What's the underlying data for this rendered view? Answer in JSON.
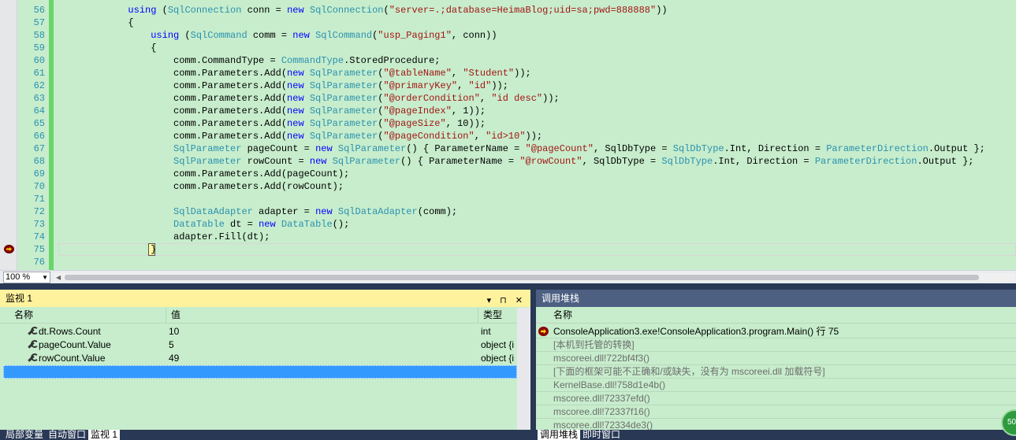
{
  "editor": {
    "lines": [
      {
        "n": "56",
        "t": [
          [
            "            ",
            ""
          ],
          [
            "using",
            "kw"
          ],
          [
            " (",
            ""
          ],
          [
            "SqlConnection",
            "ty"
          ],
          [
            " conn = ",
            ""
          ],
          [
            "new",
            "kw"
          ],
          [
            " ",
            ""
          ],
          [
            "SqlConnection",
            "ty"
          ],
          [
            "(",
            ""
          ],
          [
            "\"server=.;database=HeimaBlog;uid=sa;pwd=888888\"",
            "st"
          ],
          [
            "))",
            ""
          ]
        ]
      },
      {
        "n": "57",
        "t": [
          [
            "            {",
            ""
          ]
        ]
      },
      {
        "n": "58",
        "t": [
          [
            "                ",
            ""
          ],
          [
            "using",
            "kw"
          ],
          [
            " (",
            ""
          ],
          [
            "SqlCommand",
            "ty"
          ],
          [
            " comm = ",
            ""
          ],
          [
            "new",
            "kw"
          ],
          [
            " ",
            ""
          ],
          [
            "SqlCommand",
            "ty"
          ],
          [
            "(",
            ""
          ],
          [
            "\"usp_Paging1\"",
            "st"
          ],
          [
            ", conn))",
            ""
          ]
        ]
      },
      {
        "n": "59",
        "t": [
          [
            "                {",
            ""
          ]
        ]
      },
      {
        "n": "60",
        "t": [
          [
            "                    comm.CommandType = ",
            ""
          ],
          [
            "CommandType",
            "ty"
          ],
          [
            ".StoredProcedure;",
            ""
          ]
        ]
      },
      {
        "n": "61",
        "t": [
          [
            "                    comm.Parameters.Add(",
            ""
          ],
          [
            "new",
            "kw"
          ],
          [
            " ",
            ""
          ],
          [
            "SqlParameter",
            "ty"
          ],
          [
            "(",
            ""
          ],
          [
            "\"@tableName\"",
            "st"
          ],
          [
            ", ",
            ""
          ],
          [
            "\"Student\"",
            "st"
          ],
          [
            "));",
            ""
          ]
        ]
      },
      {
        "n": "62",
        "t": [
          [
            "                    comm.Parameters.Add(",
            ""
          ],
          [
            "new",
            "kw"
          ],
          [
            " ",
            ""
          ],
          [
            "SqlParameter",
            "ty"
          ],
          [
            "(",
            ""
          ],
          [
            "\"@primaryKey\"",
            "st"
          ],
          [
            ", ",
            ""
          ],
          [
            "\"id\"",
            "st"
          ],
          [
            "));",
            ""
          ]
        ]
      },
      {
        "n": "63",
        "t": [
          [
            "                    comm.Parameters.Add(",
            ""
          ],
          [
            "new",
            "kw"
          ],
          [
            " ",
            ""
          ],
          [
            "SqlParameter",
            "ty"
          ],
          [
            "(",
            ""
          ],
          [
            "\"@orderCondition\"",
            "st"
          ],
          [
            ", ",
            ""
          ],
          [
            "\"id desc\"",
            "st"
          ],
          [
            "));",
            ""
          ]
        ]
      },
      {
        "n": "64",
        "t": [
          [
            "                    comm.Parameters.Add(",
            ""
          ],
          [
            "new",
            "kw"
          ],
          [
            " ",
            ""
          ],
          [
            "SqlParameter",
            "ty"
          ],
          [
            "(",
            ""
          ],
          [
            "\"@pageIndex\"",
            "st"
          ],
          [
            ", 1));",
            ""
          ]
        ]
      },
      {
        "n": "65",
        "t": [
          [
            "                    comm.Parameters.Add(",
            ""
          ],
          [
            "new",
            "kw"
          ],
          [
            " ",
            ""
          ],
          [
            "SqlParameter",
            "ty"
          ],
          [
            "(",
            ""
          ],
          [
            "\"@pageSize\"",
            "st"
          ],
          [
            ", 10));",
            ""
          ]
        ]
      },
      {
        "n": "66",
        "t": [
          [
            "                    comm.Parameters.Add(",
            ""
          ],
          [
            "new",
            "kw"
          ],
          [
            " ",
            ""
          ],
          [
            "SqlParameter",
            "ty"
          ],
          [
            "(",
            ""
          ],
          [
            "\"@pageCondition\"",
            "st"
          ],
          [
            ", ",
            ""
          ],
          [
            "\"id>10\"",
            "st"
          ],
          [
            "));",
            ""
          ]
        ]
      },
      {
        "n": "67",
        "t": [
          [
            "                    ",
            ""
          ],
          [
            "SqlParameter",
            "ty"
          ],
          [
            " pageCount = ",
            ""
          ],
          [
            "new",
            "kw"
          ],
          [
            " ",
            ""
          ],
          [
            "SqlParameter",
            "ty"
          ],
          [
            "() { ParameterName = ",
            ""
          ],
          [
            "\"@pageCount\"",
            "st"
          ],
          [
            ", SqlDbType = ",
            ""
          ],
          [
            "SqlDbType",
            "ty"
          ],
          [
            ".Int, Direction = ",
            ""
          ],
          [
            "ParameterDirection",
            "ty"
          ],
          [
            ".Output };",
            ""
          ]
        ]
      },
      {
        "n": "68",
        "t": [
          [
            "                    ",
            ""
          ],
          [
            "SqlParameter",
            "ty"
          ],
          [
            " rowCount = ",
            ""
          ],
          [
            "new",
            "kw"
          ],
          [
            " ",
            ""
          ],
          [
            "SqlParameter",
            "ty"
          ],
          [
            "() { ParameterName = ",
            ""
          ],
          [
            "\"@rowCount\"",
            "st"
          ],
          [
            ", SqlDbType = ",
            ""
          ],
          [
            "SqlDbType",
            "ty"
          ],
          [
            ".Int, Direction = ",
            ""
          ],
          [
            "ParameterDirection",
            "ty"
          ],
          [
            ".Output };",
            ""
          ]
        ]
      },
      {
        "n": "69",
        "t": [
          [
            "                    comm.Parameters.Add(pageCount);",
            ""
          ]
        ]
      },
      {
        "n": "70",
        "t": [
          [
            "                    comm.Parameters.Add(rowCount);",
            ""
          ]
        ]
      },
      {
        "n": "71",
        "t": [
          [
            "",
            ""
          ]
        ]
      },
      {
        "n": "72",
        "t": [
          [
            "                    ",
            ""
          ],
          [
            "SqlDataAdapter",
            "ty"
          ],
          [
            " adapter = ",
            ""
          ],
          [
            "new",
            "kw"
          ],
          [
            " ",
            ""
          ],
          [
            "SqlDataAdapter",
            "ty"
          ],
          [
            "(comm);",
            ""
          ]
        ]
      },
      {
        "n": "73",
        "t": [
          [
            "                    ",
            ""
          ],
          [
            "DataTable",
            "ty"
          ],
          [
            " dt = ",
            ""
          ],
          [
            "new",
            "kw"
          ],
          [
            " ",
            ""
          ],
          [
            "DataTable",
            "ty"
          ],
          [
            "();",
            ""
          ]
        ]
      },
      {
        "n": "74",
        "t": [
          [
            "                    adapter.Fill(dt);",
            ""
          ]
        ]
      },
      {
        "n": "75",
        "t": [
          [
            "                }",
            ""
          ]
        ]
      },
      {
        "n": "76",
        "t": [
          [
            "",
            ""
          ]
        ]
      }
    ],
    "zoom": "100 %"
  },
  "watch": {
    "title": "监视 1",
    "tools": "▾ ⊓ ✕",
    "columns": {
      "name": "名称",
      "value": "值",
      "type": "类型"
    },
    "rows": [
      {
        "name": "dt.Rows.Count",
        "value": "10",
        "type": "int"
      },
      {
        "name": "pageCount.Value",
        "value": "5",
        "type": "object {i"
      },
      {
        "name": "rowCount.Value",
        "value": "49",
        "type": "object {i"
      }
    ]
  },
  "callstack": {
    "title": "调用堆栈",
    "column": "名称",
    "frames": [
      {
        "text": "ConsoleApplication3.exe!ConsoleApplication3.program.Main() 行 75",
        "current": true
      },
      {
        "text": "[本机到托管的转换]",
        "current": false
      },
      {
        "text": "mscoreei.dll!722bf4f3()",
        "current": false
      },
      {
        "text": "[下面的框架可能不正确和/或缺失，没有为 mscoreei.dll 加载符号]",
        "current": false
      },
      {
        "text": "KernelBase.dll!758d1e4b()",
        "current": false
      },
      {
        "text": "mscoree.dll!72337efd()",
        "current": false
      },
      {
        "text": "mscoree.dll!72337f16()",
        "current": false
      },
      {
        "text": "mscoree.dll!72334de3()",
        "current": false
      }
    ]
  },
  "bottom_tabs_left": [
    "局部变量",
    "自动窗口",
    "监视 1"
  ],
  "bottom_tabs_right": [
    "调用堆栈",
    "即时窗口"
  ],
  "badge": "50"
}
